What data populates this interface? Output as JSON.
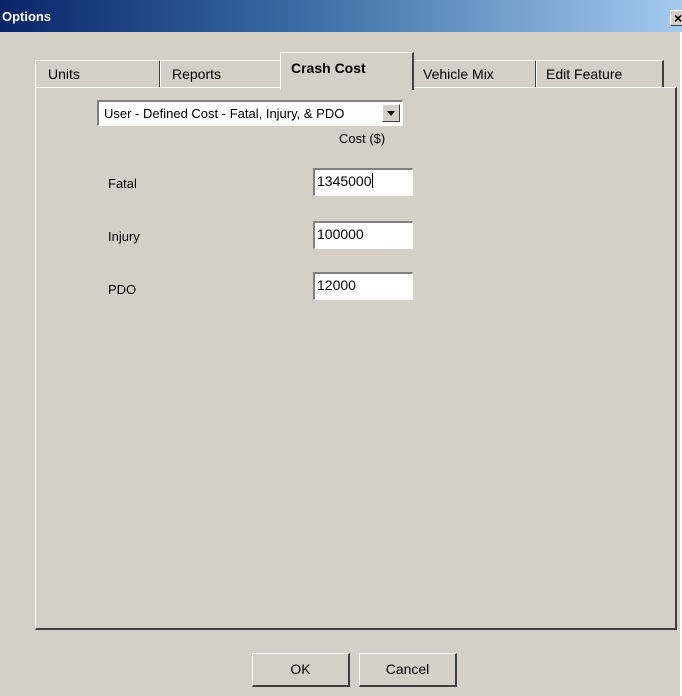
{
  "window": {
    "title": "Options",
    "close_label": "×"
  },
  "tabs": [
    {
      "label": "Units",
      "active": false
    },
    {
      "label": "Reports",
      "active": false
    },
    {
      "label": "Crash Cost",
      "active": true
    },
    {
      "label": "Vehicle Mix",
      "active": false
    },
    {
      "label": "Edit Feature",
      "active": false
    }
  ],
  "crash_cost": {
    "cost_type": "User - Defined Cost - Fatal, Injury, & PDO",
    "column_header": "Cost ($)",
    "rows": [
      {
        "label": "Fatal",
        "value": "1345000"
      },
      {
        "label": "Injury",
        "value": "100000"
      },
      {
        "label": "PDO",
        "value": "12000"
      }
    ]
  },
  "buttons": {
    "ok": "OK",
    "cancel": "Cancel"
  }
}
